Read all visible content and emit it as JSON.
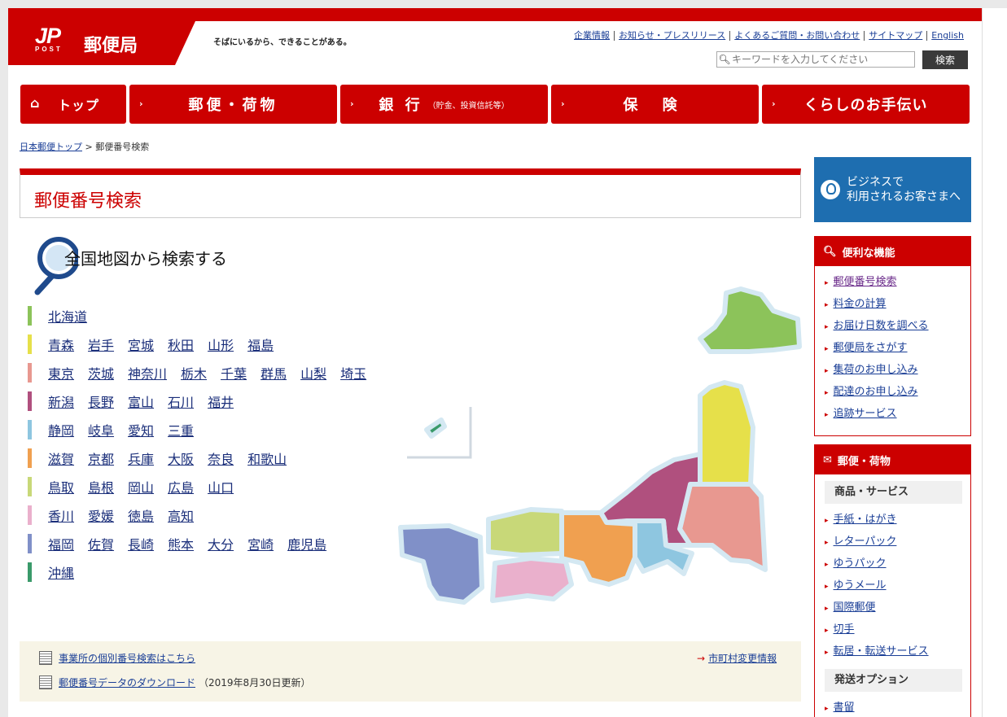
{
  "header": {
    "logo_jp": "JP",
    "logo_post": "POST",
    "logo_name": "郵便局",
    "tagline": "そばにいるから、できることがある。",
    "utility_links": [
      "企業情報",
      "お知らせ・プレスリリース",
      "よくあるご質問・お問い合わせ",
      "サイトマップ",
      "English"
    ],
    "search_placeholder": "キーワードを入力してください",
    "search_button": "検索"
  },
  "nav": [
    {
      "label": "トップ",
      "sub": ""
    },
    {
      "label": "郵便・荷物",
      "sub": ""
    },
    {
      "label": "銀 行",
      "sub": "（貯金、投資信託等）"
    },
    {
      "label": "保 険",
      "sub": ""
    },
    {
      "label": "くらしのお手伝い",
      "sub": ""
    }
  ],
  "breadcrumb": {
    "home": "日本郵便トップ",
    "sep": ">",
    "current": "郵便番号検索"
  },
  "page_title": "郵便番号検索",
  "map_title": "全国地図から検索する",
  "regions": [
    {
      "color": "#8cc35a",
      "prefs": [
        "北海道"
      ]
    },
    {
      "color": "#e6e04a",
      "prefs": [
        "青森",
        "岩手",
        "宮城",
        "秋田",
        "山形",
        "福島"
      ]
    },
    {
      "color": "#e89890",
      "prefs": [
        "東京",
        "茨城",
        "神奈川",
        "栃木",
        "千葉",
        "群馬",
        "山梨",
        "埼玉"
      ]
    },
    {
      "color": "#b0507e",
      "prefs": [
        "新潟",
        "長野",
        "富山",
        "石川",
        "福井"
      ]
    },
    {
      "color": "#8ec6e0",
      "prefs": [
        "静岡",
        "岐阜",
        "愛知",
        "三重"
      ]
    },
    {
      "color": "#f0a050",
      "prefs": [
        "滋賀",
        "京都",
        "兵庫",
        "大阪",
        "奈良",
        "和歌山"
      ]
    },
    {
      "color": "#c8d878",
      "prefs": [
        "鳥取",
        "島根",
        "岡山",
        "広島",
        "山口"
      ]
    },
    {
      "color": "#eab0cc",
      "prefs": [
        "香川",
        "愛媛",
        "徳島",
        "高知"
      ]
    },
    {
      "color": "#8090c8",
      "prefs": [
        "福岡",
        "佐賀",
        "長崎",
        "熊本",
        "大分",
        "宮崎",
        "鹿児島"
      ]
    },
    {
      "color": "#3a9a6a",
      "prefs": [
        "沖縄"
      ]
    }
  ],
  "footer_links": {
    "business": "事業所の個別番号検索はこちら",
    "municipal": "市町村変更情報",
    "download": "郵便番号データのダウンロード",
    "download_note": "（2019年8月30日更新）"
  },
  "sidebar": {
    "business_button": "ビジネスで\n利用されるお客さまへ",
    "features_title": "便利な機能",
    "features": [
      "郵便番号検索",
      "料金の計算",
      "お届け日数を調べる",
      "郵便局をさがす",
      "集荷のお申し込み",
      "配達のお申し込み",
      "追跡サービス"
    ],
    "mail_title": "郵便・荷物",
    "products_title": "商品・サービス",
    "products": [
      "手紙・はがき",
      "レターパック",
      "ゆうパック",
      "ゆうメール",
      "国際郵便",
      "切手",
      "転居・転送サービス"
    ],
    "options_title": "発送オプション",
    "options": [
      "書留"
    ]
  },
  "colors": {
    "brand_red": "#cc0000",
    "link": "#1a3e96",
    "biz_blue": "#1e6eb0"
  }
}
